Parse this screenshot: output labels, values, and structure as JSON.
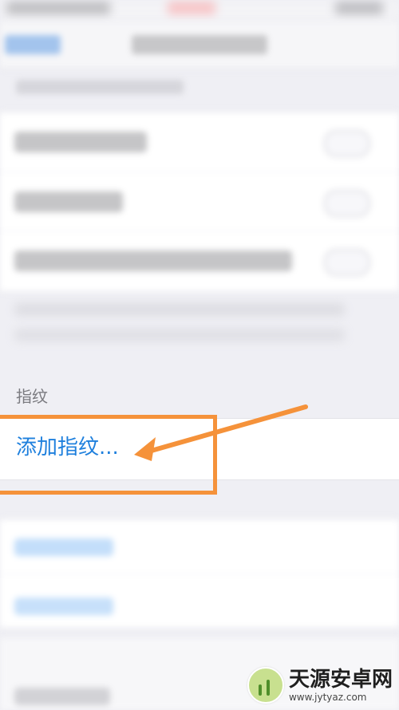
{
  "fingerprint_section": {
    "header": "指纹",
    "add_label": "添加指纹..."
  },
  "annotation": {
    "color": "#f5923a"
  },
  "watermark": {
    "title": "天源安卓网",
    "url": "www.jytyaz.com"
  }
}
